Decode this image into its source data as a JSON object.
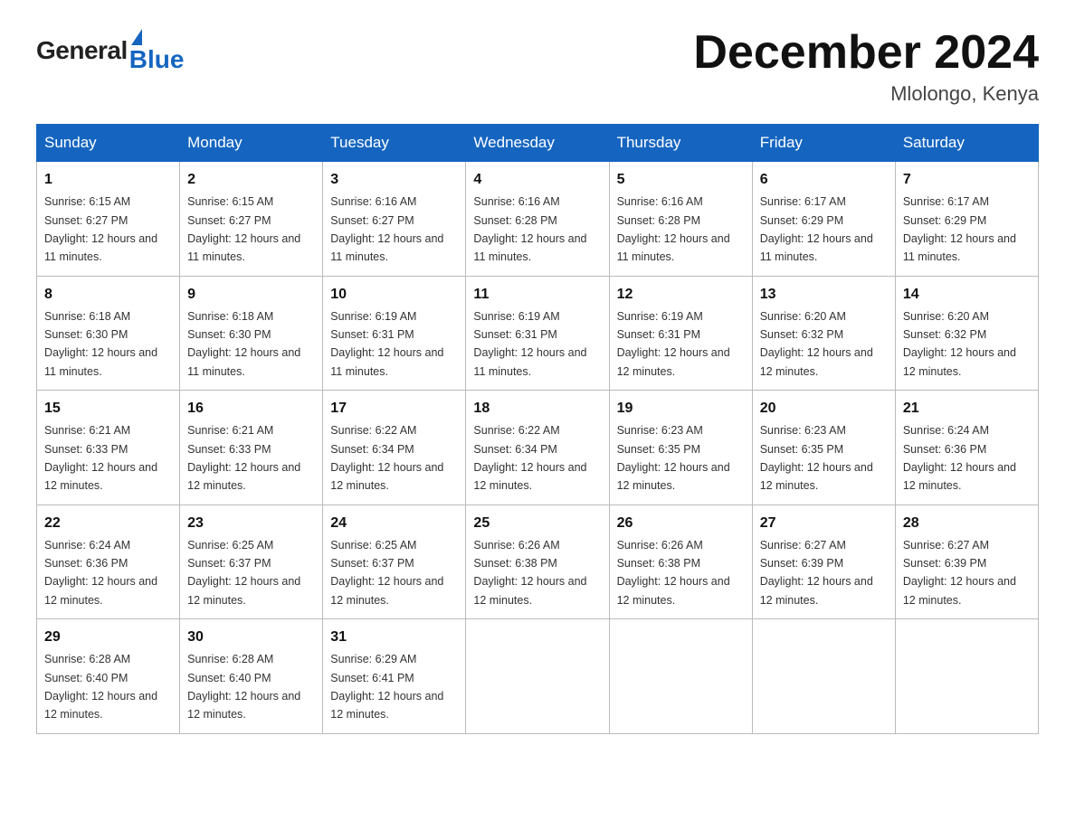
{
  "header": {
    "logo_general": "General",
    "logo_blue": "Blue",
    "month_title": "December 2024",
    "location": "Mlolongo, Kenya"
  },
  "weekdays": [
    "Sunday",
    "Monday",
    "Tuesday",
    "Wednesday",
    "Thursday",
    "Friday",
    "Saturday"
  ],
  "weeks": [
    [
      {
        "day": "1",
        "sunrise": "6:15 AM",
        "sunset": "6:27 PM",
        "daylight": "12 hours and 11 minutes."
      },
      {
        "day": "2",
        "sunrise": "6:15 AM",
        "sunset": "6:27 PM",
        "daylight": "12 hours and 11 minutes."
      },
      {
        "day": "3",
        "sunrise": "6:16 AM",
        "sunset": "6:27 PM",
        "daylight": "12 hours and 11 minutes."
      },
      {
        "day": "4",
        "sunrise": "6:16 AM",
        "sunset": "6:28 PM",
        "daylight": "12 hours and 11 minutes."
      },
      {
        "day": "5",
        "sunrise": "6:16 AM",
        "sunset": "6:28 PM",
        "daylight": "12 hours and 11 minutes."
      },
      {
        "day": "6",
        "sunrise": "6:17 AM",
        "sunset": "6:29 PM",
        "daylight": "12 hours and 11 minutes."
      },
      {
        "day": "7",
        "sunrise": "6:17 AM",
        "sunset": "6:29 PM",
        "daylight": "12 hours and 11 minutes."
      }
    ],
    [
      {
        "day": "8",
        "sunrise": "6:18 AM",
        "sunset": "6:30 PM",
        "daylight": "12 hours and 11 minutes."
      },
      {
        "day": "9",
        "sunrise": "6:18 AM",
        "sunset": "6:30 PM",
        "daylight": "12 hours and 11 minutes."
      },
      {
        "day": "10",
        "sunrise": "6:19 AM",
        "sunset": "6:31 PM",
        "daylight": "12 hours and 11 minutes."
      },
      {
        "day": "11",
        "sunrise": "6:19 AM",
        "sunset": "6:31 PM",
        "daylight": "12 hours and 11 minutes."
      },
      {
        "day": "12",
        "sunrise": "6:19 AM",
        "sunset": "6:31 PM",
        "daylight": "12 hours and 12 minutes."
      },
      {
        "day": "13",
        "sunrise": "6:20 AM",
        "sunset": "6:32 PM",
        "daylight": "12 hours and 12 minutes."
      },
      {
        "day": "14",
        "sunrise": "6:20 AM",
        "sunset": "6:32 PM",
        "daylight": "12 hours and 12 minutes."
      }
    ],
    [
      {
        "day": "15",
        "sunrise": "6:21 AM",
        "sunset": "6:33 PM",
        "daylight": "12 hours and 12 minutes."
      },
      {
        "day": "16",
        "sunrise": "6:21 AM",
        "sunset": "6:33 PM",
        "daylight": "12 hours and 12 minutes."
      },
      {
        "day": "17",
        "sunrise": "6:22 AM",
        "sunset": "6:34 PM",
        "daylight": "12 hours and 12 minutes."
      },
      {
        "day": "18",
        "sunrise": "6:22 AM",
        "sunset": "6:34 PM",
        "daylight": "12 hours and 12 minutes."
      },
      {
        "day": "19",
        "sunrise": "6:23 AM",
        "sunset": "6:35 PM",
        "daylight": "12 hours and 12 minutes."
      },
      {
        "day": "20",
        "sunrise": "6:23 AM",
        "sunset": "6:35 PM",
        "daylight": "12 hours and 12 minutes."
      },
      {
        "day": "21",
        "sunrise": "6:24 AM",
        "sunset": "6:36 PM",
        "daylight": "12 hours and 12 minutes."
      }
    ],
    [
      {
        "day": "22",
        "sunrise": "6:24 AM",
        "sunset": "6:36 PM",
        "daylight": "12 hours and 12 minutes."
      },
      {
        "day": "23",
        "sunrise": "6:25 AM",
        "sunset": "6:37 PM",
        "daylight": "12 hours and 12 minutes."
      },
      {
        "day": "24",
        "sunrise": "6:25 AM",
        "sunset": "6:37 PM",
        "daylight": "12 hours and 12 minutes."
      },
      {
        "day": "25",
        "sunrise": "6:26 AM",
        "sunset": "6:38 PM",
        "daylight": "12 hours and 12 minutes."
      },
      {
        "day": "26",
        "sunrise": "6:26 AM",
        "sunset": "6:38 PM",
        "daylight": "12 hours and 12 minutes."
      },
      {
        "day": "27",
        "sunrise": "6:27 AM",
        "sunset": "6:39 PM",
        "daylight": "12 hours and 12 minutes."
      },
      {
        "day": "28",
        "sunrise": "6:27 AM",
        "sunset": "6:39 PM",
        "daylight": "12 hours and 12 minutes."
      }
    ],
    [
      {
        "day": "29",
        "sunrise": "6:28 AM",
        "sunset": "6:40 PM",
        "daylight": "12 hours and 12 minutes."
      },
      {
        "day": "30",
        "sunrise": "6:28 AM",
        "sunset": "6:40 PM",
        "daylight": "12 hours and 12 minutes."
      },
      {
        "day": "31",
        "sunrise": "6:29 AM",
        "sunset": "6:41 PM",
        "daylight": "12 hours and 12 minutes."
      },
      null,
      null,
      null,
      null
    ]
  ],
  "labels": {
    "sunrise_prefix": "Sunrise: ",
    "sunset_prefix": "Sunset: ",
    "daylight_prefix": "Daylight: "
  }
}
